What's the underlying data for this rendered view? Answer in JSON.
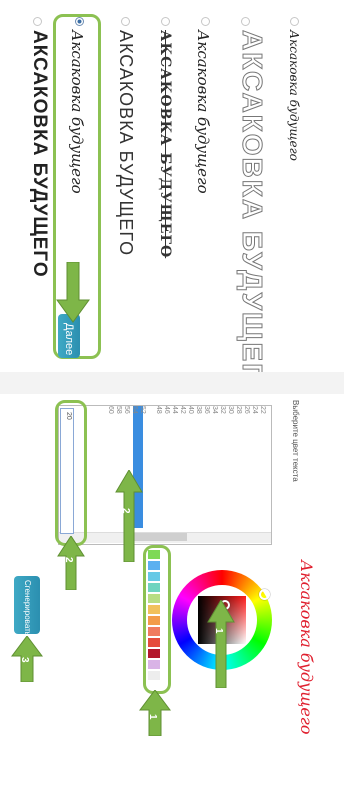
{
  "step1": {
    "options": [
      {
        "label": "Аксаковка будущего",
        "selected": false
      },
      {
        "label": "АКСАКОВКА БУДУЩЕГО",
        "selected": false
      },
      {
        "label": "Аксаковка будущего",
        "selected": false
      },
      {
        "label": "АКСАКОВКА БУДУЩЕГО",
        "selected": false
      },
      {
        "label": "АКСАКОВКА БУДУЩЕГО",
        "selected": false
      },
      {
        "label": "Аксаковка будущего",
        "selected": true
      },
      {
        "label": "АКСАКОВКА БУДУЩЕГО",
        "selected": false
      }
    ],
    "next_label": "Далее"
  },
  "step2": {
    "list_title": "Выберите цвет текста",
    "list_col1": [
      "22",
      "24",
      "26",
      "28",
      "30",
      "32",
      "34",
      "36",
      "38",
      "40",
      "42",
      "44",
      "46",
      "48",
      "50",
      "52",
      "54",
      "56",
      "58",
      "60"
    ],
    "selected_value": "50",
    "input_value": "20",
    "preview_text": "Аксаковка будущего",
    "generate_label": "Сгенерировать",
    "badges": [
      "1",
      "1",
      "2",
      "2",
      "3"
    ],
    "swatch_colors": [
      "#7ed957",
      "#5bb0f0",
      "#66c9e6",
      "#6fd4c0",
      "#b8dd83",
      "#f1c15c",
      "#f39c4a",
      "#f07b5f",
      "#e54c3c",
      "#b3182b",
      "#d9b3e6",
      "#ededed"
    ],
    "accent_red": "#e0202f",
    "accent_green": "#8cc152"
  }
}
